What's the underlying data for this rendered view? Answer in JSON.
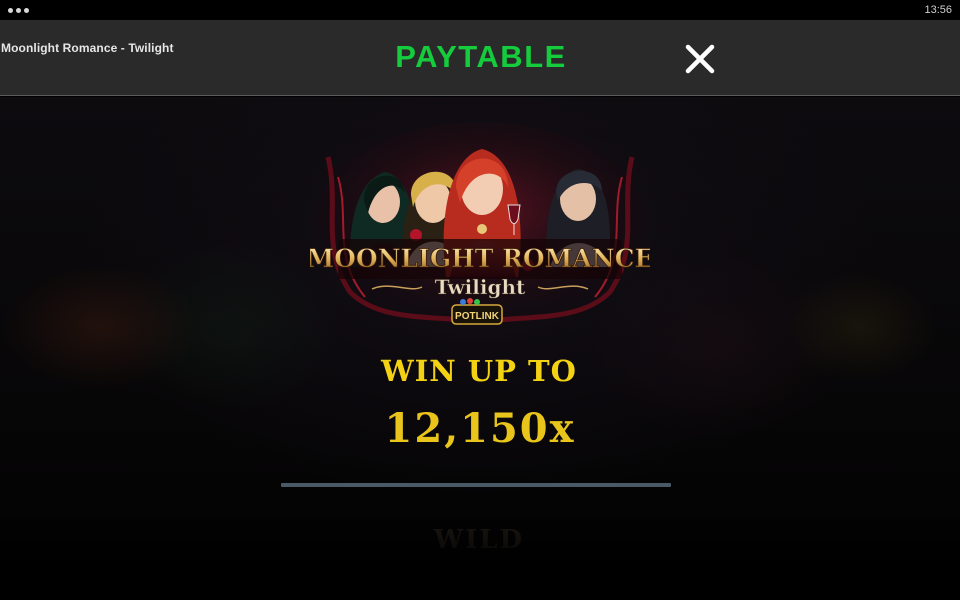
{
  "status_bar": {
    "time": "13:56",
    "menu_icon": "more-dots-icon"
  },
  "header": {
    "game_title": "Moonlight Romance - Twilight",
    "page_title": "PAYTABLE",
    "close_icon": "close-icon",
    "title_color": "#14cc3c"
  },
  "logo": {
    "title_line1": "MOONLIGHT ROMANCE",
    "title_line2": "Twilight",
    "badge": "POTLINK"
  },
  "win": {
    "label": "WIN UP TO",
    "value": "12,150x",
    "color": "#f3d214"
  },
  "next_section": {
    "title": "WILD"
  }
}
